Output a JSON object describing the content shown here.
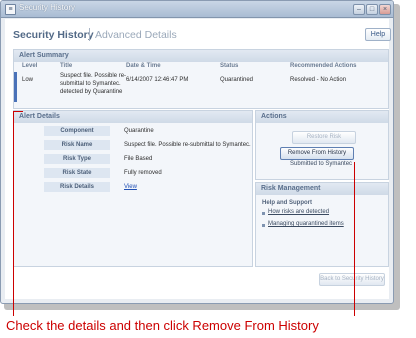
{
  "window": {
    "title": "Security History",
    "controls": [
      "minimize",
      "maximize",
      "close"
    ]
  },
  "header": {
    "title": "Security History",
    "subtitle": "Advanced Details",
    "help_label": "Help"
  },
  "alert_summary": {
    "title": "Alert Summary",
    "columns": [
      "Level",
      "Title",
      "Date & Time",
      "Status",
      "Recommended Actions"
    ],
    "row": {
      "level": "Low",
      "title_lines": [
        "Suspect file. Possible re-",
        "submittal to Symantec.",
        "detected by Quarantine"
      ],
      "datetime": "6/14/2007 12:46:47 PM",
      "status": "Quarantined",
      "recommended": "Resolved - No Action"
    }
  },
  "alert_details": {
    "title": "Alert Details",
    "rows": [
      {
        "label": "Component",
        "value": "Quarantine"
      },
      {
        "label": "Risk Name",
        "value": "Suspect file. Possible re-submittal to Symantec."
      },
      {
        "label": "Risk Type",
        "value": "File Based"
      },
      {
        "label": "Risk State",
        "value": "Fully removed"
      },
      {
        "label": "Risk Details",
        "value": "View"
      }
    ]
  },
  "actions": {
    "title": "Actions",
    "restore_label": "Restore Risk",
    "remove_label": "Remove From History",
    "submitted_text": "Submitted to Symantec"
  },
  "risk_management": {
    "title": "Risk Management",
    "help_heading": "Help and Support",
    "links": [
      "How risks are detected",
      "Managing quarantined items"
    ]
  },
  "footer": {
    "back_label": "Back to Security History"
  },
  "annotation": {
    "caption": "Check the details and then click Remove From History",
    "color": "#cc0000"
  }
}
